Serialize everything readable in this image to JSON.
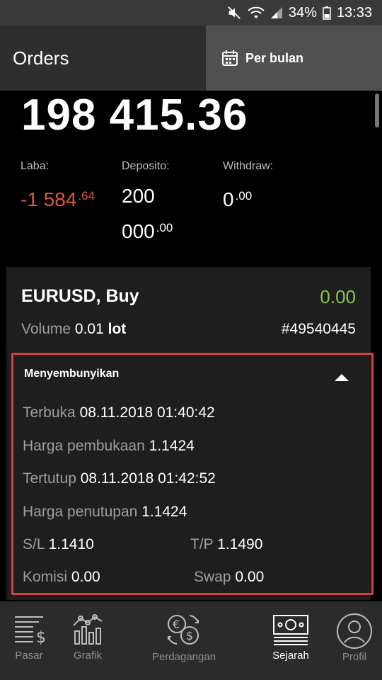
{
  "status": {
    "battery": "34%",
    "time": "13:33"
  },
  "header": {
    "title": "Orders",
    "period": "Per bulan"
  },
  "summary": {
    "balance": "198 415.36",
    "laba_label": "Laba:",
    "laba_int": "-1 584",
    "laba_dec": ".64",
    "deposito_label": "Deposito:",
    "deposito_line1": "200",
    "deposito_line2": "000",
    "deposito_dec": ".00",
    "withdraw_label": "Withdraw:",
    "withdraw_int": "0",
    "withdraw_dec": ".00"
  },
  "order": {
    "symbol": "EURUSD, Buy",
    "pnl": "0.00",
    "volume_label": "Volume",
    "volume_value": "0.01",
    "volume_unit": "lot",
    "ticket": "#49540445",
    "toggle_label": "Menyembunyikan",
    "open_time_label": "Terbuka",
    "open_time": "08.11.2018 01:40:42",
    "open_price_label": "Harga pembukaan",
    "open_price": "1.1424",
    "close_time_label": "Tertutup",
    "close_time": "08.11.2018 01:42:52",
    "close_price_label": "Harga penutupan",
    "close_price": "1.1424",
    "sl_label": "S/L",
    "sl": "1.1410",
    "tp_label": "T/P",
    "tp": "1.1490",
    "commission_label": "Komisi",
    "commission": "0.00",
    "swap_label": "Swap",
    "swap": "0.00"
  },
  "nav": {
    "items": [
      {
        "label": "Pasar",
        "icon": "market-list-icon"
      },
      {
        "label": "Grafik",
        "icon": "chart-icon"
      },
      {
        "label": "Perdagangan",
        "icon": "currency-exchange-icon"
      },
      {
        "label": "Sejarah",
        "icon": "history-banknote-icon",
        "active": true
      },
      {
        "label": "Profil",
        "icon": "profile-icon"
      }
    ]
  },
  "colors": {
    "loss": "#e1553d",
    "profit": "#8bc34a",
    "highlight": "#d64045"
  }
}
